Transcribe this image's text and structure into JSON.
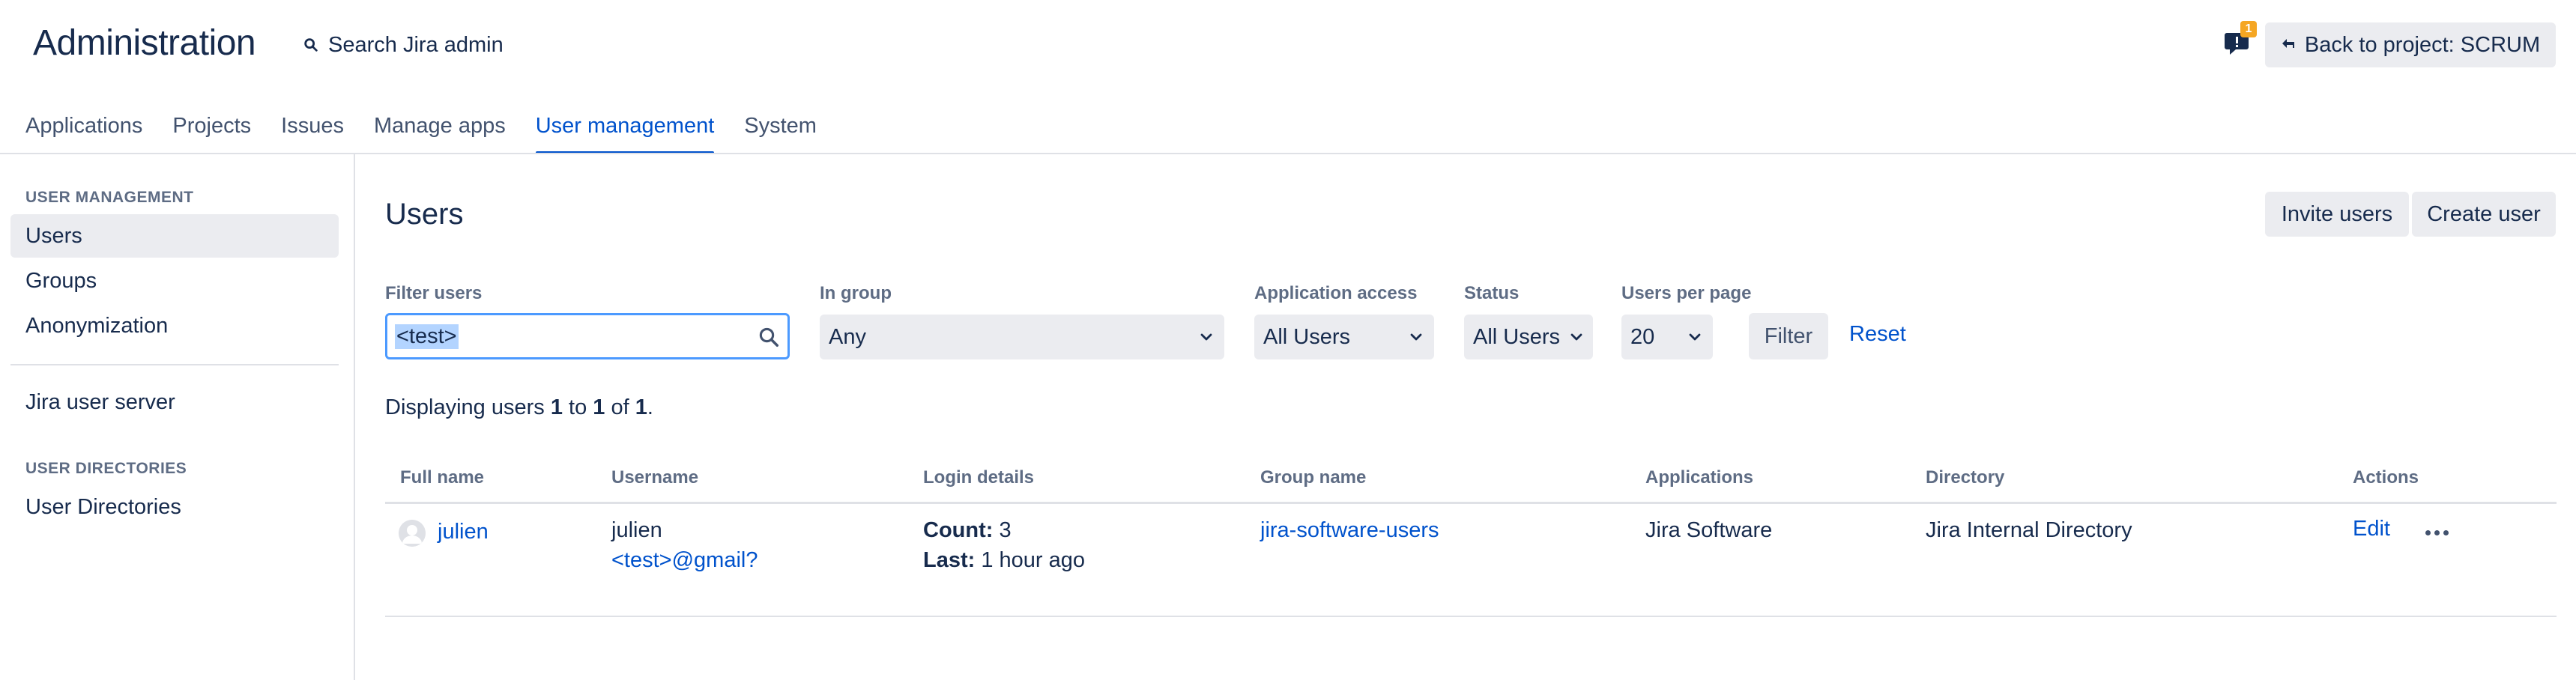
{
  "header": {
    "title": "Administration",
    "search_label": "Search Jira admin",
    "notification_count": "1",
    "back_button": "Back to project: SCRUM"
  },
  "tabs": [
    {
      "label": "Applications"
    },
    {
      "label": "Projects"
    },
    {
      "label": "Issues"
    },
    {
      "label": "Manage apps"
    },
    {
      "label": "User management",
      "active": true
    },
    {
      "label": "System"
    }
  ],
  "sidebar": {
    "section1_heading": "USER MANAGEMENT",
    "items": [
      {
        "label": "Users",
        "active": true
      },
      {
        "label": "Groups"
      },
      {
        "label": "Anonymization"
      },
      {
        "label": "Jira user server"
      }
    ],
    "section2_heading": "USER DIRECTORIES",
    "section2_items": [
      {
        "label": "User Directories"
      }
    ]
  },
  "main": {
    "title": "Users",
    "invite_button": "Invite users",
    "create_button": "Create user",
    "filters": {
      "filter_users_label": "Filter users",
      "filter_users_value": "<test>",
      "in_group_label": "In group",
      "in_group_value": "Any",
      "app_access_label": "Application access",
      "app_access_value": "All Users",
      "status_label": "Status",
      "status_value": "All Users",
      "per_page_label": "Users per page",
      "per_page_value": "20",
      "filter_button": "Filter",
      "reset_link": "Reset"
    },
    "display": {
      "prefix": "Displaying users",
      "from": "1",
      "to_word": "to",
      "to": "1",
      "of_word": "of",
      "total": "1",
      "suffix": "."
    },
    "table": {
      "columns": [
        "Full name",
        "Username",
        "Login details",
        "Group name",
        "Applications",
        "Directory",
        "Actions"
      ],
      "rows": [
        {
          "full_name": "julien",
          "username": "julien",
          "email": "<test>@gmail?",
          "count_label": "Count:",
          "count_value": "3",
          "last_label": "Last:",
          "last_value": "1 hour ago",
          "group": "jira-software-users",
          "applications": "Jira Software",
          "directory": "Jira Internal Directory",
          "edit": "Edit"
        }
      ]
    }
  },
  "colors": {
    "accent": "#0052cc",
    "text": "#172b4d",
    "subtle": "#5e6c84",
    "button_bg": "#ebecf0",
    "focus": "#4c9aff"
  }
}
